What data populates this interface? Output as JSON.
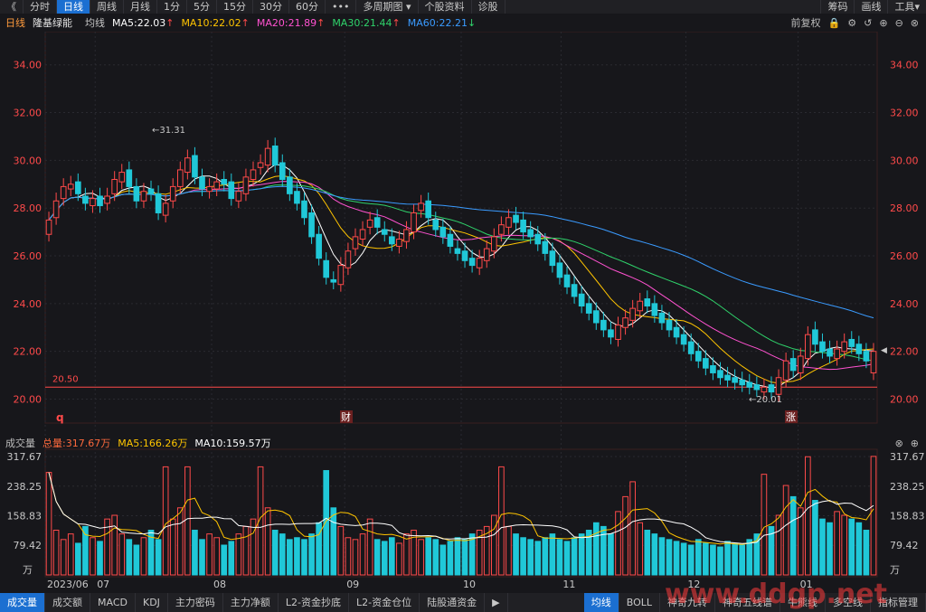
{
  "toolbar": {
    "back_icon": "《",
    "tabs": [
      "分时",
      "日线",
      "周线",
      "月线",
      "1分",
      "5分",
      "15分",
      "30分",
      "60分",
      "•••",
      "多周期图 ▾",
      "个股资料",
      "诊股"
    ],
    "active": 1,
    "right": [
      "筹码",
      "画线",
      "工具▾"
    ]
  },
  "info": {
    "period": "日线",
    "stock": "隆基绿能",
    "avg_label": "均线",
    "ma5": "MA5:22.03",
    "ma10": "MA10:22.02",
    "ma20": "MA20:21.89",
    "ma30": "MA30:21.44",
    "ma60": "MA60:22.21",
    "adjust": "前复权",
    "colors": {
      "ma5": "#ffffff",
      "ma10": "#ffc400",
      "ma20": "#ff52d0",
      "ma30": "#2fd36b",
      "ma60": "#3a9bff"
    }
  },
  "price_axis": {
    "labels": [
      "34.00",
      "32.00",
      "30.00",
      "28.00",
      "26.00",
      "24.00",
      "22.00",
      "20.00"
    ],
    "values": [
      34,
      32,
      30,
      28,
      26,
      24,
      22,
      20
    ]
  },
  "annotations": {
    "high": "31.31",
    "low": "20.01",
    "level": "20.50",
    "level_value": 20.5,
    "q_marker": "q",
    "cai_marker": "财",
    "zhang_marker": "涨"
  },
  "volume_info": {
    "title": "成交量",
    "total": "总量:317.67万",
    "ma5": "MA5:166.26万",
    "ma10": "MA10:159.57万"
  },
  "volume_axis": {
    "labels": [
      "317.67",
      "238.25",
      "158.83",
      "79.42",
      "万"
    ],
    "values": [
      317.67,
      238.25,
      158.83,
      79.42
    ]
  },
  "date_labels": [
    "2023/06",
    "07",
    "08",
    "09",
    "10",
    "11",
    "12",
    "01",
    "01"
  ],
  "bottom_tabs": [
    "成交量",
    "成交额",
    "MACD",
    "KDJ",
    "主力密码",
    "主力净额",
    "L2-资金抄底",
    "L2-资金仓位",
    "陆股通资金"
  ],
  "bottom_tabs_active": 0,
  "bottom_right": [
    "均线",
    "BOLL",
    "神奇九转",
    "神奇五线谱",
    "牛熊线",
    "多空线",
    "指标管理"
  ],
  "bottom_right_active": 0,
  "watermark": "www.ddgp.net",
  "chart_data": {
    "type": "candlestick",
    "price_range": [
      19.3,
      35.2
    ],
    "volume_range": [
      0,
      317.67
    ],
    "closes": [
      27.5,
      28.3,
      28.9,
      29.0,
      28.6,
      28.2,
      28.4,
      28.1,
      28.5,
      29.2,
      29.5,
      28.9,
      28.3,
      28.7,
      28.6,
      27.8,
      28.2,
      28.9,
      29.6,
      30.1,
      29.3,
      28.8,
      28.9,
      29.1,
      29.0,
      28.4,
      28.7,
      29.3,
      29.6,
      29.9,
      30.5,
      29.8,
      29.2,
      28.6,
      28.2,
      27.6,
      26.8,
      25.9,
      25.1,
      24.9,
      25.6,
      26.2,
      26.8,
      27.1,
      27.5,
      27.2,
      26.9,
      26.5,
      26.7,
      27.1,
      27.8,
      28.2,
      27.6,
      27.1,
      26.8,
      26.4,
      26.1,
      25.8,
      25.6,
      25.9,
      26.3,
      26.8,
      27.3,
      27.6,
      27.4,
      27.0,
      26.8,
      26.5,
      26.1,
      25.6,
      25.1,
      24.7,
      24.3,
      23.9,
      23.6,
      23.2,
      22.9,
      22.6,
      23.1,
      23.4,
      23.8,
      24.1,
      23.9,
      23.5,
      23.2,
      22.9,
      22.6,
      22.3,
      21.9,
      21.6,
      21.3,
      21.1,
      20.9,
      20.8,
      20.7,
      20.6,
      20.5,
      20.4,
      20.5,
      20.3,
      20.9,
      21.6,
      21.2,
      21.8,
      22.7,
      22.3,
      22.0,
      21.8,
      22.1,
      22.4,
      22.2,
      21.9,
      21.6,
      22.0
    ],
    "opens": [
      26.9,
      27.6,
      28.4,
      28.8,
      29.1,
      28.5,
      28.1,
      28.5,
      28.2,
      28.6,
      29.1,
      29.6,
      28.9,
      28.3,
      28.8,
      28.6,
      27.7,
      28.3,
      28.9,
      29.5,
      30.2,
      29.3,
      28.7,
      28.8,
      29.2,
      29.1,
      28.3,
      28.6,
      29.2,
      29.7,
      29.8,
      30.6,
      29.9,
      29.3,
      28.7,
      28.3,
      27.8,
      26.9,
      25.8,
      25.0,
      24.8,
      25.5,
      26.3,
      26.7,
      27.2,
      27.6,
      27.1,
      26.8,
      26.4,
      26.6,
      27.0,
      27.9,
      28.3,
      27.5,
      27.2,
      26.9,
      26.3,
      26.2,
      25.9,
      25.5,
      25.8,
      26.2,
      26.9,
      27.2,
      27.7,
      27.5,
      27.1,
      26.9,
      26.6,
      26.2,
      25.7,
      25.2,
      24.8,
      24.4,
      24.0,
      23.7,
      23.3,
      22.9,
      22.5,
      23.0,
      23.3,
      23.7,
      24.2,
      24.0,
      23.6,
      23.3,
      23.0,
      22.7,
      22.4,
      22.0,
      21.7,
      21.4,
      21.2,
      21.0,
      20.9,
      20.8,
      20.7,
      20.6,
      20.3,
      20.6,
      20.2,
      20.8,
      21.7,
      21.1,
      21.7,
      22.9,
      22.4,
      22.1,
      21.7,
      22.0,
      22.5,
      22.3,
      22.0,
      21.1
    ],
    "volumes": [
      275,
      120,
      95,
      110,
      85,
      130,
      100,
      90,
      150,
      160,
      110,
      95,
      80,
      100,
      120,
      95,
      290,
      150,
      180,
      290,
      120,
      95,
      110,
      100,
      80,
      90,
      110,
      130,
      150,
      290,
      180,
      120,
      110,
      95,
      100,
      95,
      110,
      140,
      280,
      180,
      130,
      100,
      95,
      110,
      150,
      95,
      90,
      100,
      85,
      110,
      120,
      95,
      100,
      95,
      80,
      90,
      100,
      95,
      110,
      120,
      130,
      160,
      290,
      130,
      110,
      100,
      95,
      90,
      100,
      110,
      95,
      90,
      100,
      110,
      120,
      140,
      130,
      110,
      170,
      210,
      250,
      140,
      120,
      110,
      100,
      95,
      90,
      85,
      80,
      95,
      85,
      80,
      75,
      90,
      85,
      80,
      95,
      110,
      270,
      130,
      160,
      240,
      210,
      180,
      317,
      200,
      150,
      140,
      170,
      160,
      150,
      140,
      120,
      318
    ]
  }
}
